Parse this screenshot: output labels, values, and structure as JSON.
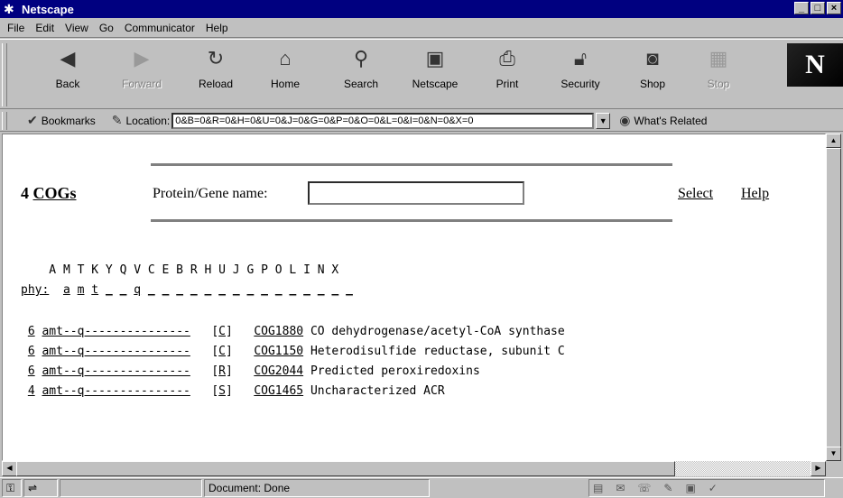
{
  "window": {
    "title": "Netscape",
    "minimize": "_",
    "maximize": "□",
    "close": "×"
  },
  "menu": [
    "File",
    "Edit",
    "View",
    "Go",
    "Communicator",
    "Help"
  ],
  "toolbar": {
    "back": "Back",
    "forward": "Forward",
    "reload": "Reload",
    "home": "Home",
    "search": "Search",
    "netscape": "Netscape",
    "print": "Print",
    "security": "Security",
    "shop": "Shop",
    "stop": "Stop",
    "logo": "N"
  },
  "location": {
    "bookmarks": "Bookmarks",
    "label": "Location:",
    "url": "0&B=0&R=0&H=0&U=0&J=0&G=0&P=0&O=0&L=0&I=0&N=0&X=0",
    "related": "What's Related"
  },
  "page": {
    "cogs_count_num": "4",
    "cogs_count_link": "COGs",
    "protein_label": "Protein/Gene name:",
    "protein_value": "",
    "select_link": "Select",
    "help_link": "Help",
    "letters_header": "    A M T K Y Q V C E B R H U J G P O L I N X",
    "phy_label": "phy:",
    "phy_values": [
      "a",
      "m",
      "t",
      "_",
      "_",
      "q",
      "_",
      "_",
      "_",
      "_",
      "_",
      "_",
      "_",
      "_",
      "_",
      "_",
      "_",
      "_",
      "_",
      "_",
      "_"
    ],
    "rows": [
      {
        "count": "6",
        "pattern": "amt--q---------------",
        "cat": "C",
        "cog": "COG1880",
        "desc": "CO dehydrogenase/acetyl-CoA synthase"
      },
      {
        "count": "6",
        "pattern": "amt--q---------------",
        "cat": "C",
        "cog": "COG1150",
        "desc": "Heterodisulfide reductase, subunit C"
      },
      {
        "count": "6",
        "pattern": "amt--q---------------",
        "cat": "R",
        "cog": "COG2044",
        "desc": "Predicted peroxiredoxins"
      },
      {
        "count": "4",
        "pattern": "amt--q---------------",
        "cat": "S",
        "cog": "COG1465",
        "desc": "Uncharacterized ACR"
      }
    ]
  },
  "status": {
    "text": "Document: Done"
  }
}
